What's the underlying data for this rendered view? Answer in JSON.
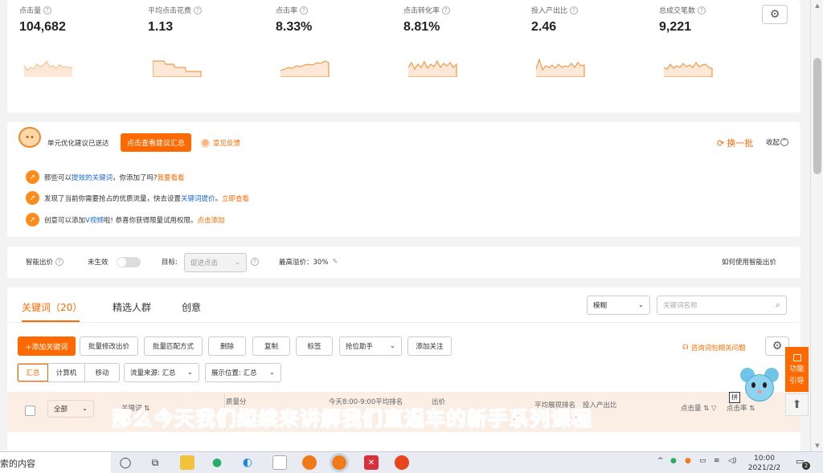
{
  "metrics": [
    {
      "label": "点击量",
      "value": "104,682"
    },
    {
      "label": "平均点击花费",
      "value": "1.13"
    },
    {
      "label": "点击率",
      "value": "8.33%"
    },
    {
      "label": "点击转化率",
      "value": "8.81%"
    },
    {
      "label": "投入产出比",
      "value": "2.46"
    },
    {
      "label": "总成交笔数",
      "value": "9,221"
    }
  ],
  "suggest": {
    "sent_text": "单元优化建议已送达",
    "view_button": "点击查看建议汇总",
    "feedback": "意见反馈",
    "refresh": "换一批",
    "collapse": "收起",
    "tips": [
      {
        "pre": "那些可以",
        "hl": "提效的关键词",
        "post": "，你添加了吗?",
        "link": "我要看看"
      },
      {
        "pre": "发现了当前你需要抢占的优质流量，快去设置",
        "hl": "关键词提价",
        "post": "。",
        "link": "立即查看"
      },
      {
        "pre": "创意可以添加",
        "hl": "V视频",
        "post": "啦! 恭喜你获得限量试用权限。",
        "link": "点击添加"
      }
    ]
  },
  "smartbid": {
    "label": "智能出价",
    "status": "未生效",
    "target_label": "目标:",
    "target_value": "促进点击",
    "max_premium": "最高溢价：30%",
    "help": "如何使用智能出价"
  },
  "keywords": {
    "tabs": [
      "关键词（20）",
      "精选人群",
      "创意"
    ],
    "match_select": "模糊",
    "search_placeholder": "关键词名称",
    "buttons": [
      "+添加关键词",
      "批量修改出价",
      "批量匹配方式",
      "删除",
      "复制",
      "标签",
      "抢位助手",
      "添加关注"
    ],
    "faq": "咨询词包相关问题",
    "device_tabs": [
      "汇总",
      "计算机",
      "移动"
    ],
    "source_select": "流量来源: 汇总",
    "position_select": "展示位置: 汇总",
    "headers": {
      "all": "全部",
      "keyword": "关键词",
      "quality": "质量分",
      "rank_time": "今天8:00-9:00平均排名",
      "bid": "出价",
      "avg_rank": "平均展现排名",
      "roi": "投入产出比",
      "clicks": "点击量",
      "ctr": "点击率",
      "ime": "拼"
    }
  },
  "float": {
    "func_line1": "功能",
    "func_line2": "引导"
  },
  "subtitle": "那么今天我们继续来讲解我们直通车的新手系列课程",
  "taskbar": {
    "search_text": "索的内容",
    "time": "10:00",
    "date": "2021/2/2",
    "notif_count": "2"
  }
}
